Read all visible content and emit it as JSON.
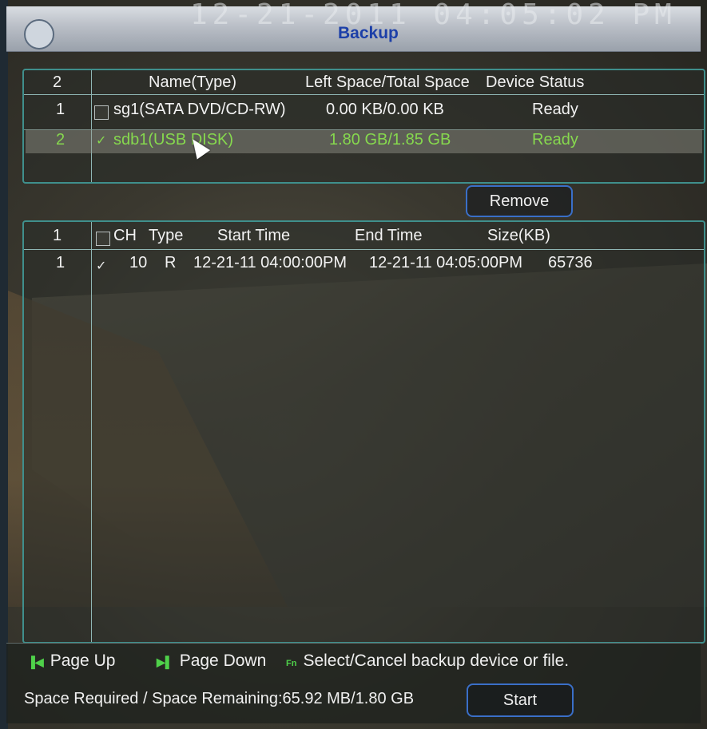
{
  "window": {
    "title": "Backup",
    "timestamp_ghost": "12-21-2011  04:05:02 PM"
  },
  "devices": {
    "count_header": "2",
    "headers": {
      "name": "Name(Type)",
      "space": "Left Space/Total Space",
      "status": "Device Status"
    },
    "rows": [
      {
        "index": "1",
        "checked": false,
        "name": "sg1(SATA DVD/CD-RW)",
        "space": "0.00 KB/0.00 KB",
        "status": "Ready",
        "selected": false
      },
      {
        "index": "2",
        "checked": true,
        "name": "sdb1(USB DISK)",
        "space": "1.80 GB/1.85 GB",
        "status": "Ready",
        "selected": true
      }
    ]
  },
  "remove_button": {
    "label": "Remove"
  },
  "files": {
    "count_header": "1",
    "headers": {
      "ch": "CH",
      "type": "Type",
      "start": "Start Time",
      "end": "End Time",
      "size": "Size(KB)"
    },
    "rows": [
      {
        "index": "1",
        "checked": true,
        "ch": "10",
        "type": "R",
        "start": "12-21-11 04:00:00PM",
        "end": "12-21-11 04:05:00PM",
        "size": "65736"
      }
    ]
  },
  "footer": {
    "page_up": {
      "icon": "page-up-icon",
      "label": "Page Up"
    },
    "page_down": {
      "icon": "page-down-icon",
      "label": "Page Down"
    },
    "fn_hint": {
      "icon": "fn-key-icon",
      "label": "Select/Cancel backup device or file."
    },
    "space_text": "Space Required / Space Remaining:65.92 MB/1.80 GB",
    "start_button": {
      "label": "Start"
    }
  },
  "colors": {
    "accent_green": "#86d84e",
    "panel_border": "#3f8f8c",
    "button_border": "#3a6fc8",
    "title_blue": "#1c3fa8"
  }
}
